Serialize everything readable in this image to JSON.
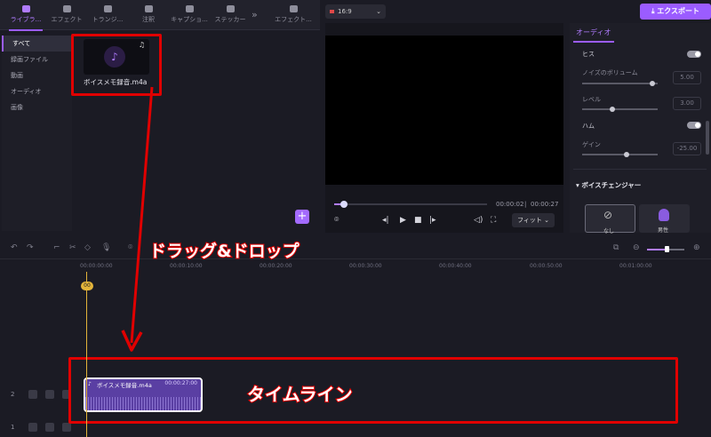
{
  "tabs": [
    {
      "label": "ライブラ..."
    },
    {
      "label": "エフェクト"
    },
    {
      "label": "トランジ..."
    },
    {
      "label": "注釈"
    },
    {
      "label": "キャプショ..."
    },
    {
      "label": "ステッカー"
    },
    {
      "label": "エフェクト..."
    }
  ],
  "more_tabs": "»",
  "sidebar": {
    "items": [
      {
        "label": "すべて"
      },
      {
        "label": "録画ファイル"
      },
      {
        "label": "動画"
      },
      {
        "label": "オーディオ"
      },
      {
        "label": "画像"
      }
    ]
  },
  "library": {
    "file_name": "ボイスメモ録音.m4a",
    "add_label": "+"
  },
  "preview": {
    "ratio_label": "16:9",
    "time_current": "00:00:02",
    "time_total": "00:00:27",
    "fit_label": "フィット ⌄",
    "progress": 0.05
  },
  "export_label": "⤓ エクスポート",
  "audio": {
    "tab_label": "オーディオ",
    "hiss_label": "ヒス",
    "noise_volume_label": "ノイズのボリューム",
    "noise_volume_value": "5.00",
    "level_label": "レベル",
    "level_value": "3.00",
    "hum_label": "ハム",
    "gain_label": "ゲイン",
    "gain_value": "-25.00",
    "voice_changer_label": "▾ ボイスチェンジャー",
    "voice_none_label": "なし",
    "voice_2_label": "男性"
  },
  "timeline": {
    "ruler_ticks": [
      "00:00:00:00",
      "00:00:10:00",
      "00:00:20:00",
      "00:00:30:00",
      "00:00:40:00",
      "00:00:50:00",
      "00:01:00:00"
    ],
    "playhead_label": "00",
    "clip_name": "ボイスメモ録音.m4a",
    "clip_duration": "00:00:27:00",
    "track_labels": [
      "2",
      "1"
    ]
  },
  "annotations": {
    "drag_drop": "ドラッグ&ドロップ",
    "timeline": "タイムライン"
  }
}
